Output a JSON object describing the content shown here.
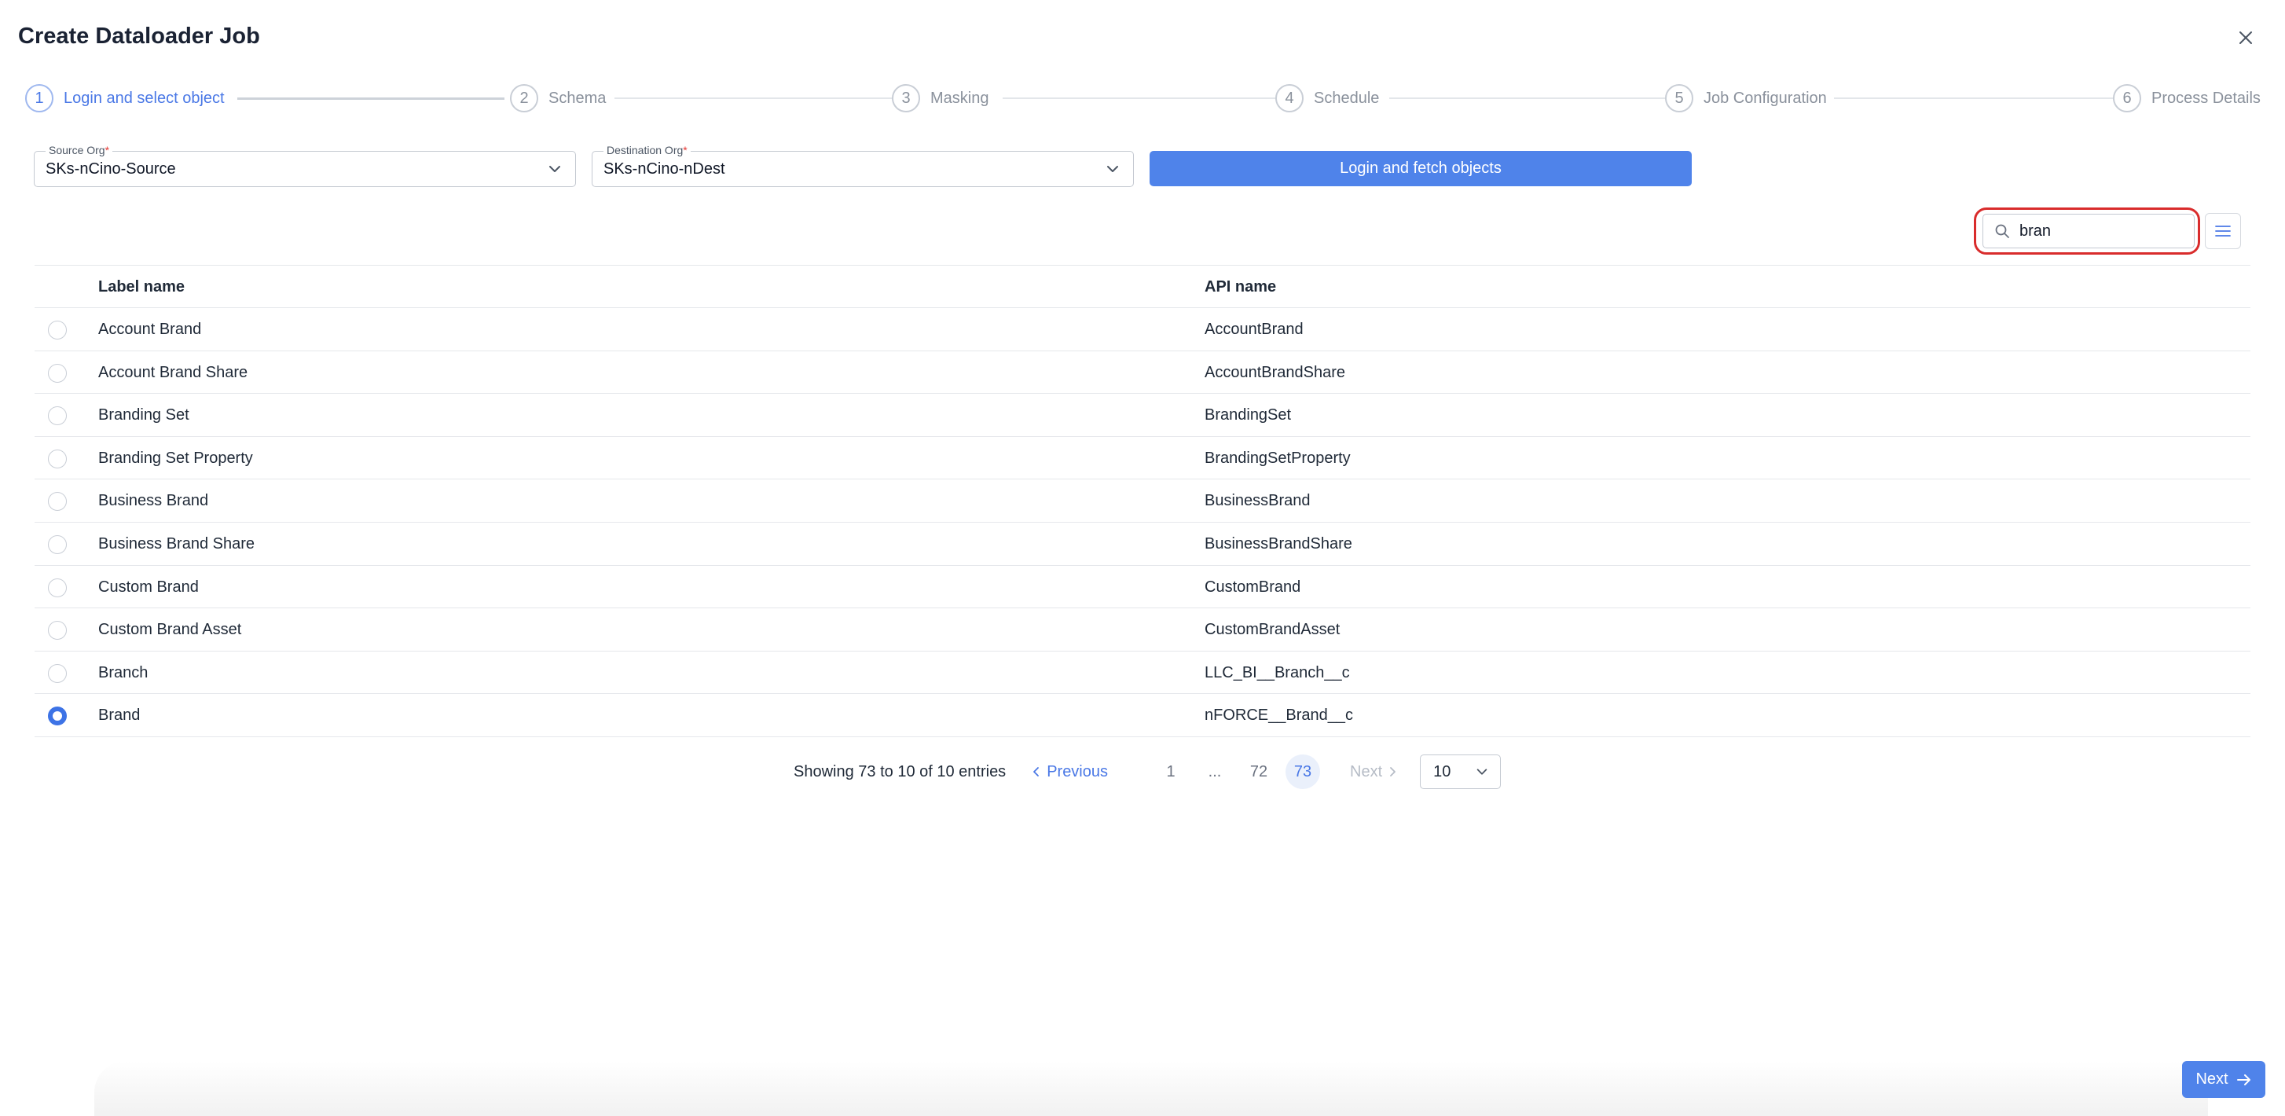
{
  "dialog": {
    "title": "Create Dataloader Job"
  },
  "steps": [
    {
      "number": "1",
      "label": "Login and select object"
    },
    {
      "number": "2",
      "label": "Schema"
    },
    {
      "number": "3",
      "label": "Masking"
    },
    {
      "number": "4",
      "label": "Schedule"
    },
    {
      "number": "5",
      "label": "Job Configuration"
    },
    {
      "number": "6",
      "label": "Process Details"
    }
  ],
  "active_step": 1,
  "source_org": {
    "label": "Source Org",
    "required_mark": "*",
    "value": "SKs-nCino-Source"
  },
  "destination_org": {
    "label": "Destination Org",
    "required_mark": "*",
    "value": "SKs-nCino-nDest"
  },
  "fetch_button": "Login and fetch objects",
  "search": {
    "value": "bran"
  },
  "table": {
    "headers": [
      "Label name",
      "API name"
    ],
    "rows": [
      {
        "label": "Account Brand",
        "api": "AccountBrand",
        "selected": false
      },
      {
        "label": "Account Brand Share",
        "api": "AccountBrandShare",
        "selected": false
      },
      {
        "label": "Branding Set",
        "api": "BrandingSet",
        "selected": false
      },
      {
        "label": "Branding Set Property",
        "api": "BrandingSetProperty",
        "selected": false
      },
      {
        "label": "Business Brand",
        "api": "BusinessBrand",
        "selected": false
      },
      {
        "label": "Business Brand Share",
        "api": "BusinessBrandShare",
        "selected": false
      },
      {
        "label": "Custom Brand",
        "api": "CustomBrand",
        "selected": false
      },
      {
        "label": "Custom Brand Asset",
        "api": "CustomBrandAsset",
        "selected": false
      },
      {
        "label": "Branch",
        "api": "LLC_BI__Branch__c",
        "selected": false
      },
      {
        "label": "Brand",
        "api": "nFORCE__Brand__c",
        "selected": true
      }
    ]
  },
  "pagination": {
    "info": "Showing 73 to 10 of 10 entries",
    "previous": "Previous",
    "pages": [
      "1",
      "...",
      "72",
      "73"
    ],
    "current": "73",
    "next": "Next",
    "page_size": "10"
  },
  "footer": {
    "next_button": "Next"
  },
  "colors": {
    "primary": "#4f83ea",
    "highlight_outline": "#d92c2c"
  }
}
